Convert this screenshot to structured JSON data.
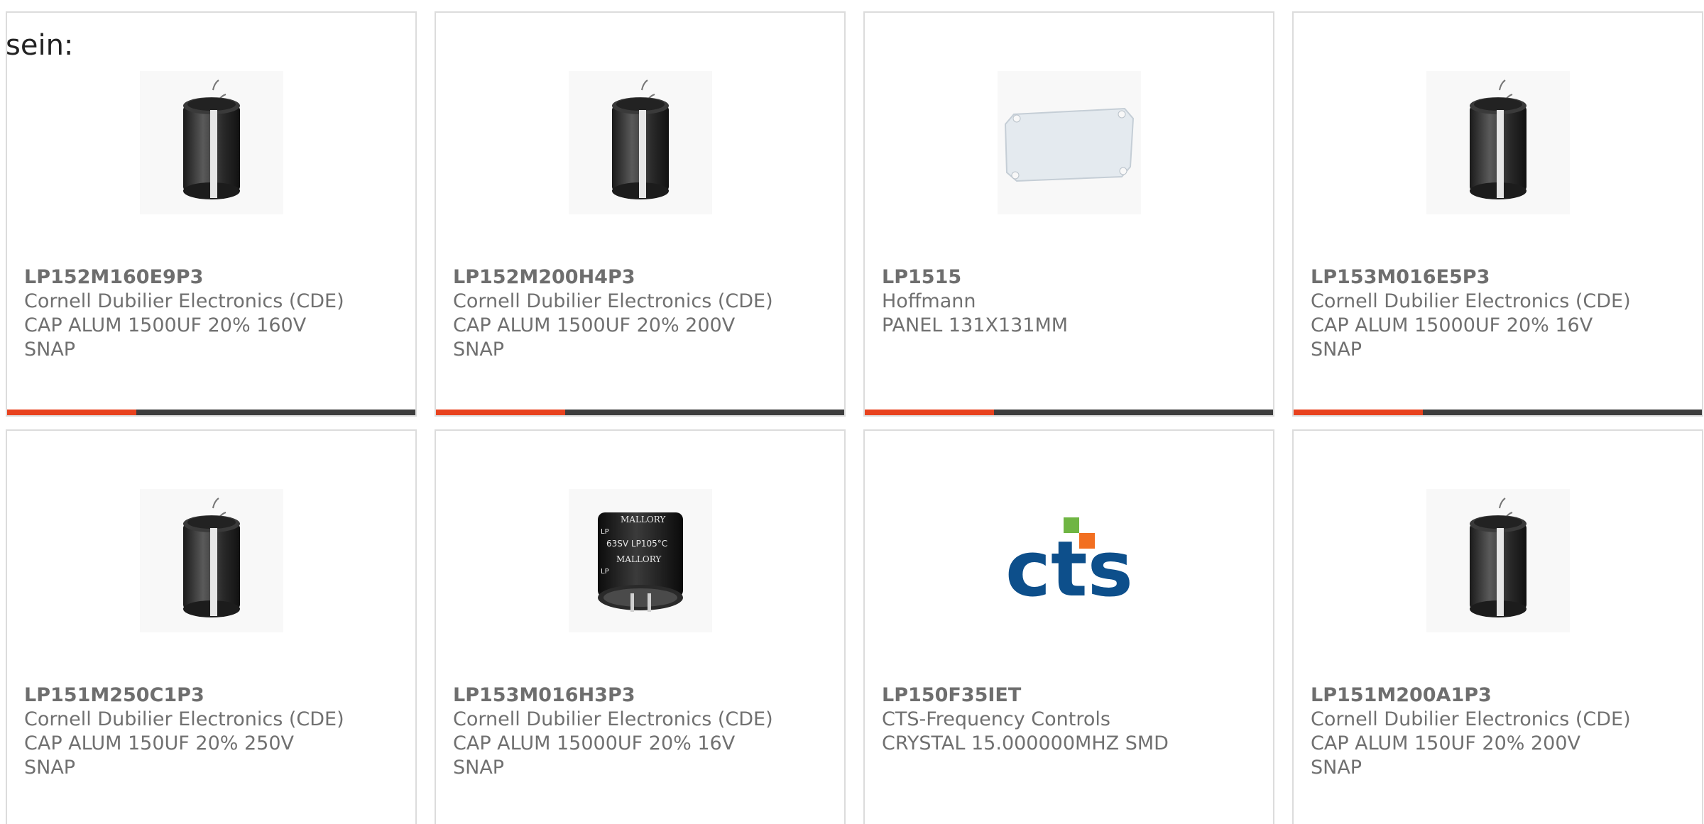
{
  "lead_text": "sein:",
  "colors": {
    "accent": "#e8421e",
    "bar_dark": "#3d3d3d",
    "card_border": "#dcdcdc",
    "text_gray": "#707070"
  },
  "products": [
    {
      "part": "LP152M160E9P3",
      "manufacturer": "Cornell Dubilier Electronics (CDE)",
      "desc1": "CAP ALUM 1500UF 20% 160V",
      "desc2": "SNAP",
      "image": "snap-in-capacitor-icon"
    },
    {
      "part": "LP152M200H4P3",
      "manufacturer": "Cornell Dubilier Electronics (CDE)",
      "desc1": "CAP ALUM 1500UF 20% 200V",
      "desc2": "SNAP",
      "image": "snap-in-capacitor-icon"
    },
    {
      "part": "LP1515",
      "manufacturer": "Hoffmann",
      "desc1": "PANEL 131X131MM",
      "desc2": "",
      "image": "panel-icon"
    },
    {
      "part": "LP153M016E5P3",
      "manufacturer": "Cornell Dubilier Electronics (CDE)",
      "desc1": "CAP ALUM 15000UF 20% 16V",
      "desc2": "SNAP",
      "image": "snap-in-capacitor-icon"
    },
    {
      "part": "LP151M250C1P3",
      "manufacturer": "Cornell Dubilier Electronics (CDE)",
      "desc1": "CAP ALUM 150UF 20% 250V",
      "desc2": "SNAP",
      "image": "snap-in-capacitor-icon"
    },
    {
      "part": "LP153M016H3P3",
      "manufacturer": "Cornell Dubilier Electronics (CDE)",
      "desc1": "CAP ALUM 15000UF 20% 16V",
      "desc2": "SNAP",
      "image": "mallory-capacitor-icon",
      "image_text": [
        "MALLORY",
        "LP",
        "63SV LP105°C",
        "MALLORY",
        "LP"
      ]
    },
    {
      "part": "LP150F35IET",
      "manufacturer": "CTS-Frequency Controls",
      "desc1": "CRYSTAL 15.000000MHZ SMD",
      "desc2": "",
      "image": "cts-logo",
      "image_text": [
        "cts"
      ]
    },
    {
      "part": "LP151M200A1P3",
      "manufacturer": "Cornell Dubilier Electronics (CDE)",
      "desc1": "CAP ALUM 150UF 20% 200V",
      "desc2": "SNAP",
      "image": "snap-in-capacitor-icon"
    }
  ]
}
